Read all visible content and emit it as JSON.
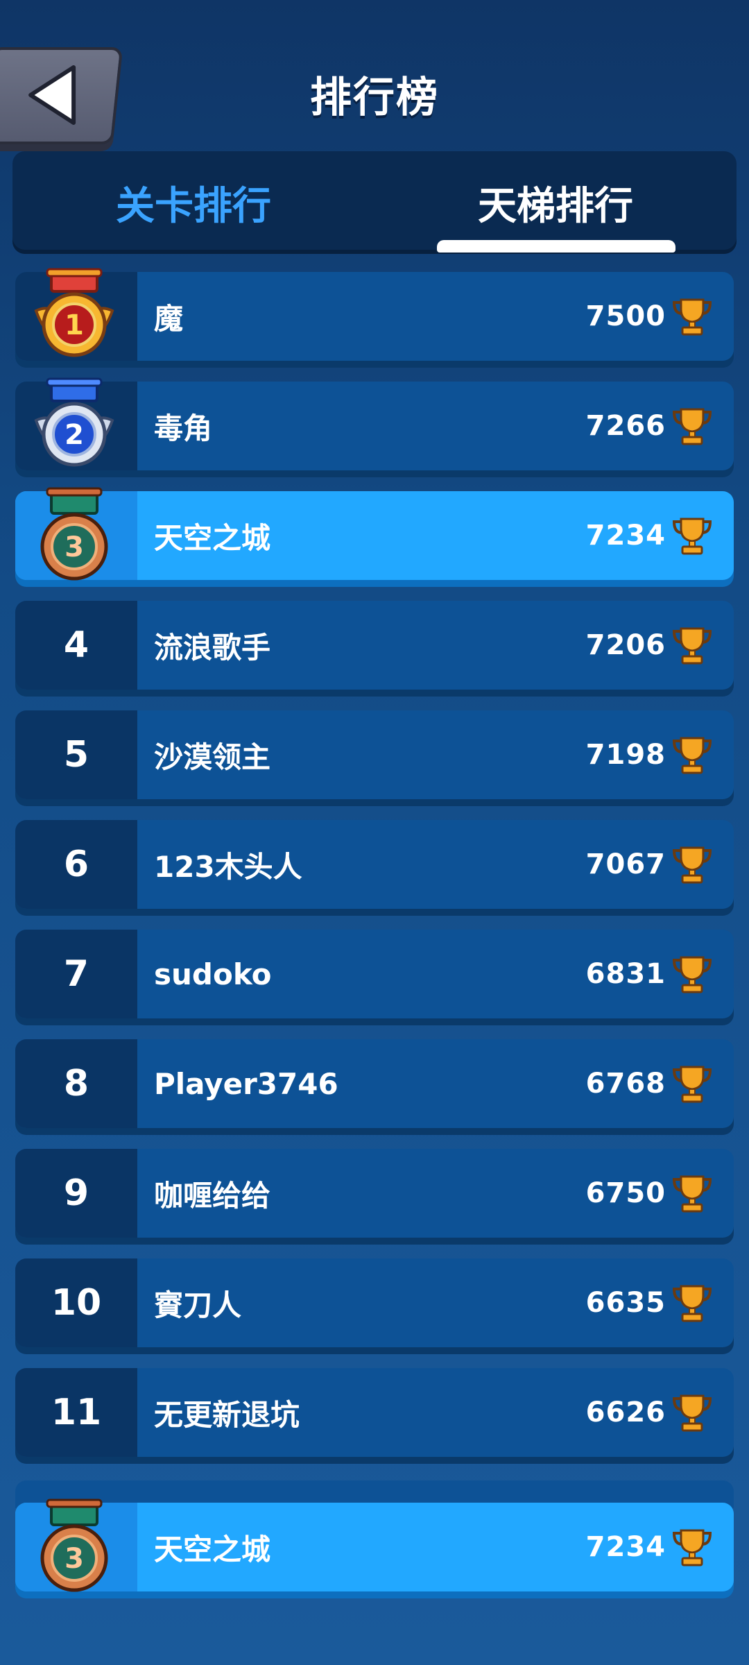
{
  "header": {
    "title": "排行榜"
  },
  "tabs": [
    {
      "label": "关卡排行",
      "active": false
    },
    {
      "label": "天梯排行",
      "active": true
    }
  ],
  "rankings": [
    {
      "rank": "1",
      "name": "魔",
      "score": "7500",
      "medal": "gold"
    },
    {
      "rank": "2",
      "name": "毒角",
      "score": "7266",
      "medal": "silver"
    },
    {
      "rank": "3",
      "name": "天空之城",
      "score": "7234",
      "medal": "bronze",
      "is_current_user": true
    },
    {
      "rank": "4",
      "name": "流浪歌手",
      "score": "7206"
    },
    {
      "rank": "5",
      "name": "沙漠领主",
      "score": "7198"
    },
    {
      "rank": "6",
      "name": "123木头人",
      "score": "7067"
    },
    {
      "rank": "7",
      "name": "sudoko",
      "score": "6831"
    },
    {
      "rank": "8",
      "name": "Player3746",
      "score": "6768"
    },
    {
      "rank": "9",
      "name": "咖喱给给",
      "score": "6750"
    },
    {
      "rank": "10",
      "name": "賨刀人",
      "score": "6635"
    },
    {
      "rank": "11",
      "name": "无更新退坑",
      "score": "6626"
    }
  ],
  "my_rank": {
    "rank": "3",
    "name": "天空之城",
    "score": "7234",
    "medal": "bronze"
  },
  "colors": {
    "background": "#134b86",
    "row": "#0d5296",
    "row_highlight": "#22a8ff",
    "tab_active": "#ffffff",
    "tab_inactive": "#3aa3ff",
    "trophy": "#f5a623"
  },
  "icons": {
    "back": "back-arrow-icon",
    "trophy": "trophy-icon",
    "gold_medal": "gold-medal-icon",
    "silver_medal": "silver-medal-icon",
    "bronze_medal": "bronze-medal-icon"
  }
}
